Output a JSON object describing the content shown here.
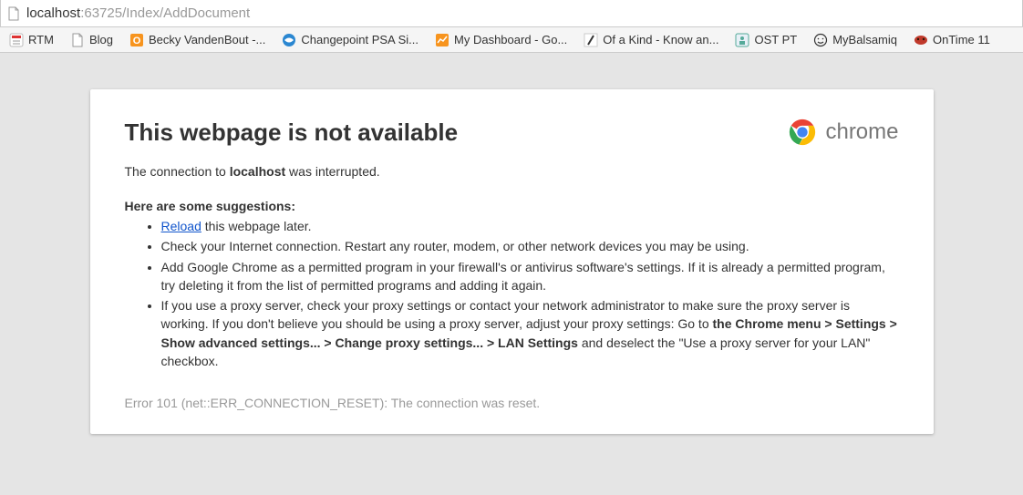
{
  "address": {
    "host": "localhost",
    "path": ":63725/Index/AddDocument"
  },
  "bookmarks": [
    {
      "label": "RTM",
      "icon": "rtm"
    },
    {
      "label": "Blog",
      "icon": "page"
    },
    {
      "label": "Becky VandenBout -...",
      "icon": "orange-o"
    },
    {
      "label": "Changepoint PSA Si...",
      "icon": "blue-globe"
    },
    {
      "label": "My Dashboard - Go...",
      "icon": "analytics"
    },
    {
      "label": "Of a Kind - Know an...",
      "icon": "slash"
    },
    {
      "label": "OST PT",
      "icon": "ost"
    },
    {
      "label": "MyBalsamiq",
      "icon": "smile"
    },
    {
      "label": "OnTime 11",
      "icon": "ontime"
    }
  ],
  "error": {
    "title": "This webpage is not available",
    "brand": "chrome",
    "msg_prefix": "The connection to ",
    "msg_host": "localhost",
    "msg_suffix": " was interrupted.",
    "suggest_header": "Here are some suggestions:",
    "reload_link": "Reload",
    "reload_rest": " this webpage later.",
    "sugg2": "Check your Internet connection. Restart any router, modem, or other network devices you may be using.",
    "sugg3": "Add Google Chrome as a permitted program in your firewall's or antivirus software's settings. If it is already a permitted program, try deleting it from the list of permitted programs and adding it again.",
    "sugg4_a": "If you use a proxy server, check your proxy settings or contact your network administrator to make sure the proxy server is working. If you don't believe you should be using a proxy server, adjust your proxy settings: Go to ",
    "sugg4_bold": "the Chrome menu > Settings > Show advanced settings... > Change proxy settings... > LAN Settings",
    "sugg4_b": " and deselect the \"Use a proxy server for your LAN\" checkbox.",
    "code": "Error 101 (net::ERR_CONNECTION_RESET): The connection was reset."
  }
}
